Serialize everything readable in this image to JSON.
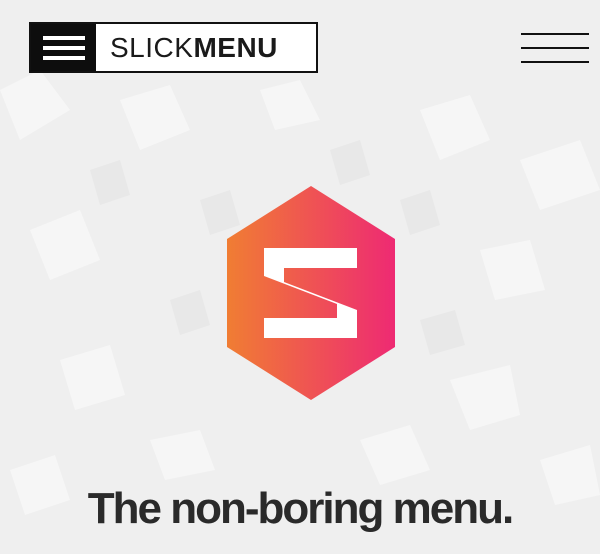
{
  "header": {
    "logo_text_light": "SLICK",
    "logo_text_bold": "MENU",
    "logo_icon": "hamburger-icon",
    "menu_toggle_icon": "hamburger-icon"
  },
  "hero": {
    "emblem_icon": "s-hexagon-icon",
    "emblem_gradient": [
      "#f07d33",
      "#ee2a73"
    ],
    "headline": "The non-boring menu."
  },
  "colors": {
    "background": "#efefef",
    "text": "#2a2a2a",
    "accent_start": "#f07d33",
    "accent_end": "#ee2a73"
  }
}
